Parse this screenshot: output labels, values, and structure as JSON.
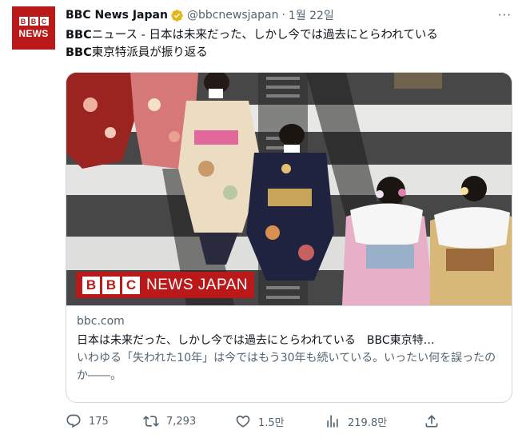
{
  "account": {
    "display_name": "BBC News Japan",
    "handle": "@bbcnewsjapan",
    "separator": "·",
    "date": "1월 22일",
    "avatar_blocks": [
      "B",
      "B",
      "C"
    ],
    "avatar_word": "NEWS",
    "verified": true
  },
  "more_label": "···",
  "tweet": {
    "line1_bold": "BBC",
    "line1_rest": "ニュース - 日本は未来だった、しかし今では過去にとらわれている",
    "line2_bold": "BBC",
    "line2_rest": "東京特派員が振り返る"
  },
  "card": {
    "image_alt": "Women in kimono crossing a street",
    "overlay_blocks": [
      "B",
      "B",
      "C"
    ],
    "overlay_words": "NEWS JAPAN",
    "domain": "bbc.com",
    "title": "日本は未来だった、しかし今では過去にとらわれている　BBC東京特…",
    "description": "いわゆる「失われた10年」は今ではもう30年も続いている。いったい何を誤ったのか――。"
  },
  "actions": {
    "reply_count": "175",
    "retweet_count": "7,293",
    "like_count": "1.5만",
    "views_count": "219.8만"
  },
  "colors": {
    "bbc_red": "#bb1919",
    "text": "#0f1419",
    "muted": "#536471",
    "verified_gold": "#e2b719",
    "border": "#cfd9de"
  },
  "icons": [
    "verified-badge-icon",
    "more-icon",
    "reply-icon",
    "retweet-icon",
    "like-icon",
    "views-icon",
    "share-icon"
  ]
}
